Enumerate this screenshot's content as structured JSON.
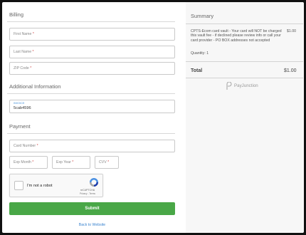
{
  "billing": {
    "title": "Billing",
    "first_name": "First Name",
    "last_name": "Last Name",
    "zip": "ZIP Code",
    "required_mark": "*"
  },
  "additional": {
    "title": "Additional Information",
    "invoice_label": "Invoice",
    "invoice_value": "5cab4596"
  },
  "payment": {
    "title": "Payment",
    "card_number": "Card Number",
    "exp_month": "Exp Month",
    "exp_year": "Exp Year",
    "cvv": "CVV"
  },
  "recaptcha": {
    "label": "I'm not a robot",
    "brand": "reCAPTCHA",
    "links": "Privacy - Terms"
  },
  "submit_label": "Submit",
  "back_link": "Back to Website",
  "summary": {
    "title": "Summary",
    "description": "CPTS-Ecom card vault - Your card will NOT be charged this vault fee - if declined please review info or call your card provider - PO BOX addresses not accepted",
    "price": "$1.00",
    "quantity": "Quantity: 1",
    "total_label": "Total",
    "total_value": "$1.00",
    "provider": "PayJunction"
  },
  "colors": {
    "accent_green": "#49a747",
    "link_blue": "#3b84cf",
    "required_red": "#d14b4b"
  }
}
